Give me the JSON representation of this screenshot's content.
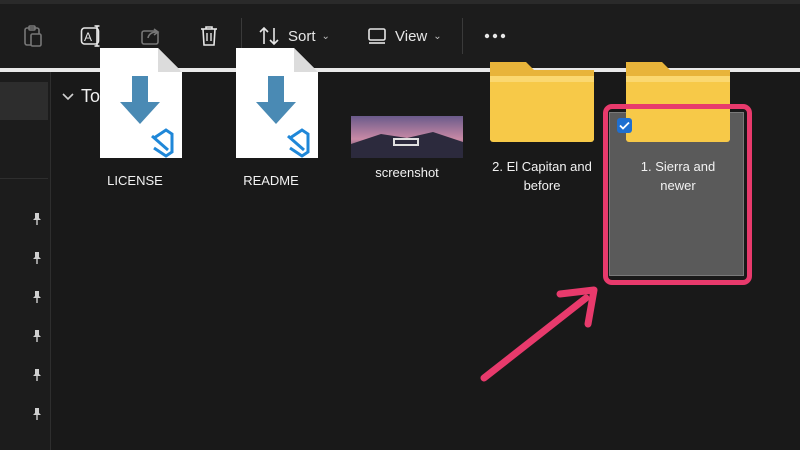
{
  "toolbar": {
    "paste_icon": "clipboard-icon",
    "rename_icon": "rename-icon",
    "share_icon": "share-icon",
    "delete_icon": "trash-icon",
    "sort_label": "Sort",
    "view_label": "View",
    "more_icon": "ellipsis-icon"
  },
  "group": {
    "label": "Today"
  },
  "files": [
    {
      "name": "LICENSE",
      "type": "vscode-file"
    },
    {
      "name": "README",
      "type": "vscode-file"
    },
    {
      "name": "screenshot",
      "type": "image-thumbnail"
    },
    {
      "name": "2. El Capitan and before",
      "type": "folder"
    },
    {
      "name": "1. Sierra and newer",
      "type": "folder",
      "selected": true
    }
  ],
  "colors": {
    "background": "#191919",
    "highlight": "#e83a6c",
    "folder": "#f7c948",
    "vscode_arrow": "#4a8ab4",
    "vscode_logo": "#1f87d8",
    "checkbox": "#1f6fd0"
  }
}
